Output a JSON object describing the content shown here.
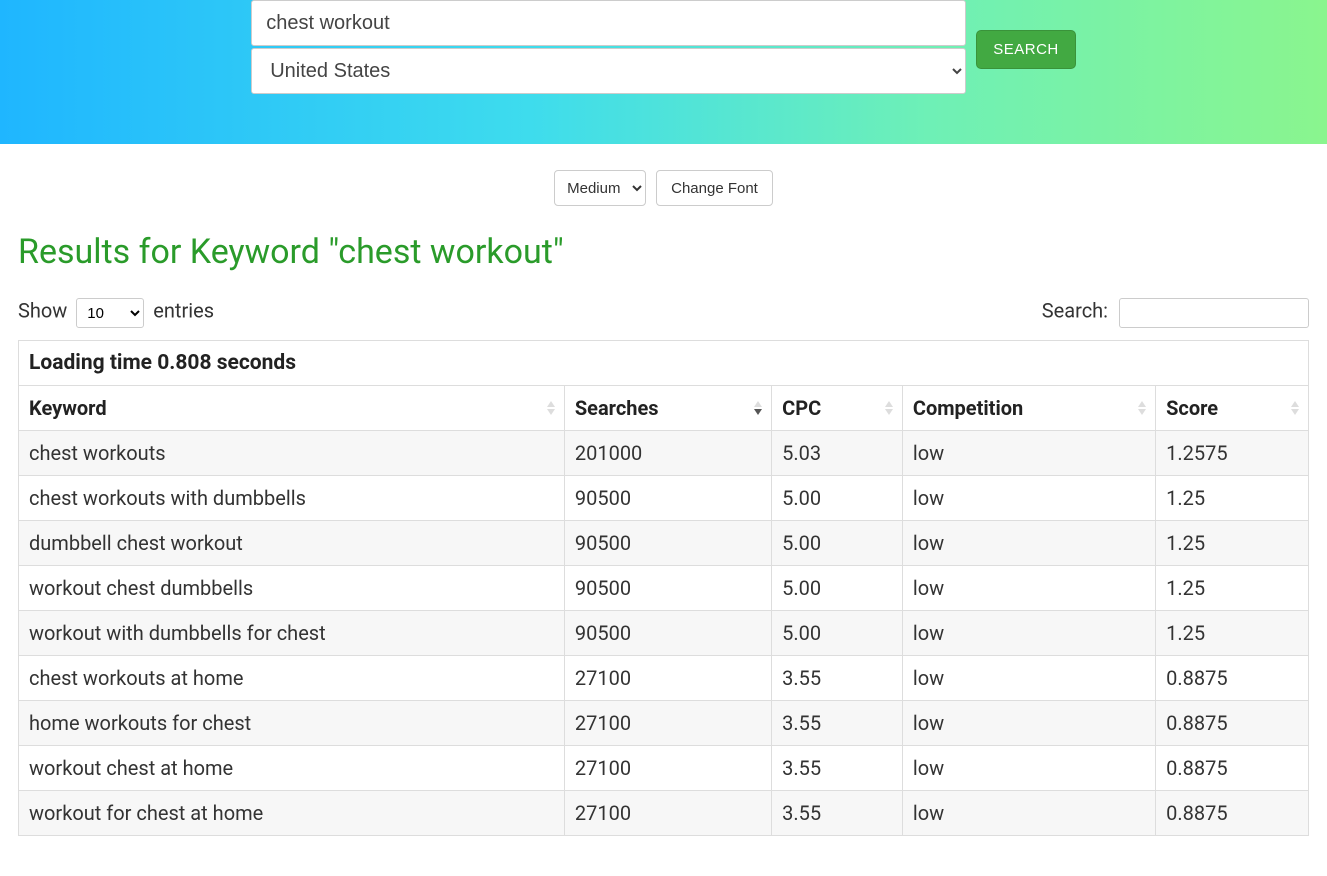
{
  "hero": {
    "keyword_value": "chest workout",
    "country_selected": "United States",
    "search_label": "SEARCH"
  },
  "controls": {
    "font_size_selected": "Medium",
    "change_font_label": "Change Font"
  },
  "results": {
    "heading": "Results for Keyword \"chest workout\"",
    "show_label_before": "Show",
    "show_label_after": "entries",
    "show_selected": "10",
    "search_label": "Search:",
    "search_value": "",
    "loading_time_text": "Loading time 0.808 seconds",
    "columns": [
      "Keyword",
      "Searches",
      "CPC",
      "Competition",
      "Score"
    ],
    "sorted_column_index": 1,
    "sorted_direction": "desc",
    "rows": [
      {
        "keyword": "chest workouts",
        "searches": "201000",
        "cpc": "5.03",
        "competition": "low",
        "score": "1.2575"
      },
      {
        "keyword": "chest workouts with dumbbells",
        "searches": "90500",
        "cpc": "5.00",
        "competition": "low",
        "score": "1.25"
      },
      {
        "keyword": "dumbbell chest workout",
        "searches": "90500",
        "cpc": "5.00",
        "competition": "low",
        "score": "1.25"
      },
      {
        "keyword": "workout chest dumbbells",
        "searches": "90500",
        "cpc": "5.00",
        "competition": "low",
        "score": "1.25"
      },
      {
        "keyword": "workout with dumbbells for chest",
        "searches": "90500",
        "cpc": "5.00",
        "competition": "low",
        "score": "1.25"
      },
      {
        "keyword": "chest workouts at home",
        "searches": "27100",
        "cpc": "3.55",
        "competition": "low",
        "score": "0.8875"
      },
      {
        "keyword": "home workouts for chest",
        "searches": "27100",
        "cpc": "3.55",
        "competition": "low",
        "score": "0.8875"
      },
      {
        "keyword": "workout chest at home",
        "searches": "27100",
        "cpc": "3.55",
        "competition": "low",
        "score": "0.8875"
      },
      {
        "keyword": "workout for chest at home",
        "searches": "27100",
        "cpc": "3.55",
        "competition": "low",
        "score": "0.8875"
      }
    ]
  },
  "colors": {
    "accent_green": "#2a9b2a",
    "button_green": "#42a942"
  }
}
